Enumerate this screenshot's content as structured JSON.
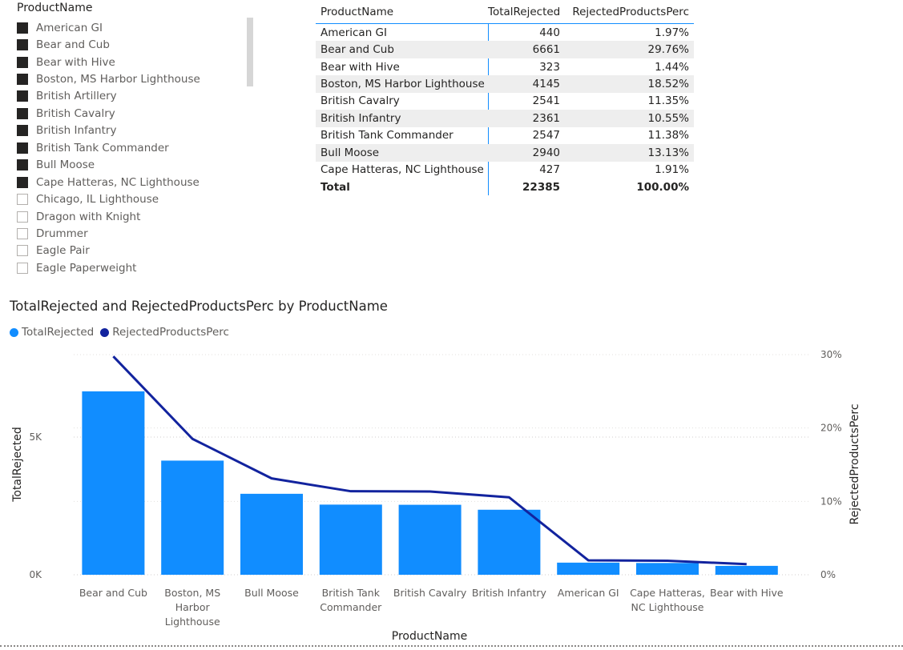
{
  "slicer": {
    "title": "ProductName",
    "items": [
      {
        "label": "American GI",
        "checked": true
      },
      {
        "label": "Bear and Cub",
        "checked": true
      },
      {
        "label": "Bear with Hive",
        "checked": true
      },
      {
        "label": "Boston, MS Harbor Lighthouse",
        "checked": true
      },
      {
        "label": "British Artillery",
        "checked": true
      },
      {
        "label": "British Cavalry",
        "checked": true
      },
      {
        "label": "British Infantry",
        "checked": true
      },
      {
        "label": "British Tank Commander",
        "checked": true
      },
      {
        "label": "Bull Moose",
        "checked": true
      },
      {
        "label": "Cape Hatteras, NC Lighthouse",
        "checked": true
      },
      {
        "label": "Chicago, IL Lighthouse",
        "checked": false
      },
      {
        "label": "Dragon with Knight",
        "checked": false
      },
      {
        "label": "Drummer",
        "checked": false
      },
      {
        "label": "Eagle Pair",
        "checked": false
      },
      {
        "label": "Eagle Paperweight",
        "checked": false
      }
    ]
  },
  "table": {
    "headers": [
      "ProductName",
      "TotalRejected",
      "RejectedProductsPerc"
    ],
    "rows": [
      [
        "American GI",
        "440",
        "1.97%"
      ],
      [
        "Bear and Cub",
        "6661",
        "29.76%"
      ],
      [
        "Bear with Hive",
        "323",
        "1.44%"
      ],
      [
        "Boston, MS Harbor Lighthouse",
        "4145",
        "18.52%"
      ],
      [
        "British Cavalry",
        "2541",
        "11.35%"
      ],
      [
        "British Infantry",
        "2361",
        "10.55%"
      ],
      [
        "British Tank Commander",
        "2547",
        "11.38%"
      ],
      [
        "Bull Moose",
        "2940",
        "13.13%"
      ],
      [
        "Cape Hatteras, NC Lighthouse",
        "427",
        "1.91%"
      ]
    ],
    "total": [
      "Total",
      "22385",
      "100.00%"
    ]
  },
  "chart_data": {
    "type": "bar",
    "title": "TotalRejected and RejectedProductsPerc by ProductName",
    "xlabel": "ProductName",
    "ylabel": "TotalRejected",
    "y2label": "RejectedProductsPerc",
    "categories": [
      "Bear and Cub",
      "Boston, MS Harbor Lighthouse",
      "Bull Moose",
      "British Tank Commander",
      "British Cavalry",
      "British Infantry",
      "American GI",
      "Cape Hatteras, NC Lighthouse",
      "Bear with Hive"
    ],
    "category_labels": [
      [
        "Bear and Cub"
      ],
      [
        "Boston, MS",
        "Harbor",
        "Lighthouse"
      ],
      [
        "Bull Moose"
      ],
      [
        "British Tank",
        "Commander"
      ],
      [
        "British Cavalry"
      ],
      [
        "British Infantry"
      ],
      [
        "American GI"
      ],
      [
        "Cape Hatteras,",
        "NC Lighthouse"
      ],
      [
        "Bear with Hive"
      ]
    ],
    "series": [
      {
        "name": "TotalRejected",
        "type": "bar",
        "axis": "left",
        "color": "#118dff",
        "values": [
          6661,
          4145,
          2940,
          2547,
          2541,
          2361,
          440,
          427,
          323
        ]
      },
      {
        "name": "RejectedProductsPerc",
        "type": "line",
        "axis": "right",
        "color": "#12239e",
        "values": [
          29.76,
          18.52,
          13.13,
          11.38,
          11.35,
          10.55,
          1.97,
          1.91,
          1.44
        ]
      }
    ],
    "ylim": [
      0,
      8000
    ],
    "y_ticks": [
      {
        "value": 0,
        "label": "0K"
      },
      {
        "value": 5000,
        "label": "5K"
      }
    ],
    "y2lim": [
      0,
      30
    ],
    "y2_ticks": [
      {
        "value": 0,
        "label": "0%"
      },
      {
        "value": 10,
        "label": "10%"
      },
      {
        "value": 20,
        "label": "20%"
      },
      {
        "value": 30,
        "label": "30%"
      }
    ],
    "grid": true,
    "legend_position": "top-left"
  }
}
